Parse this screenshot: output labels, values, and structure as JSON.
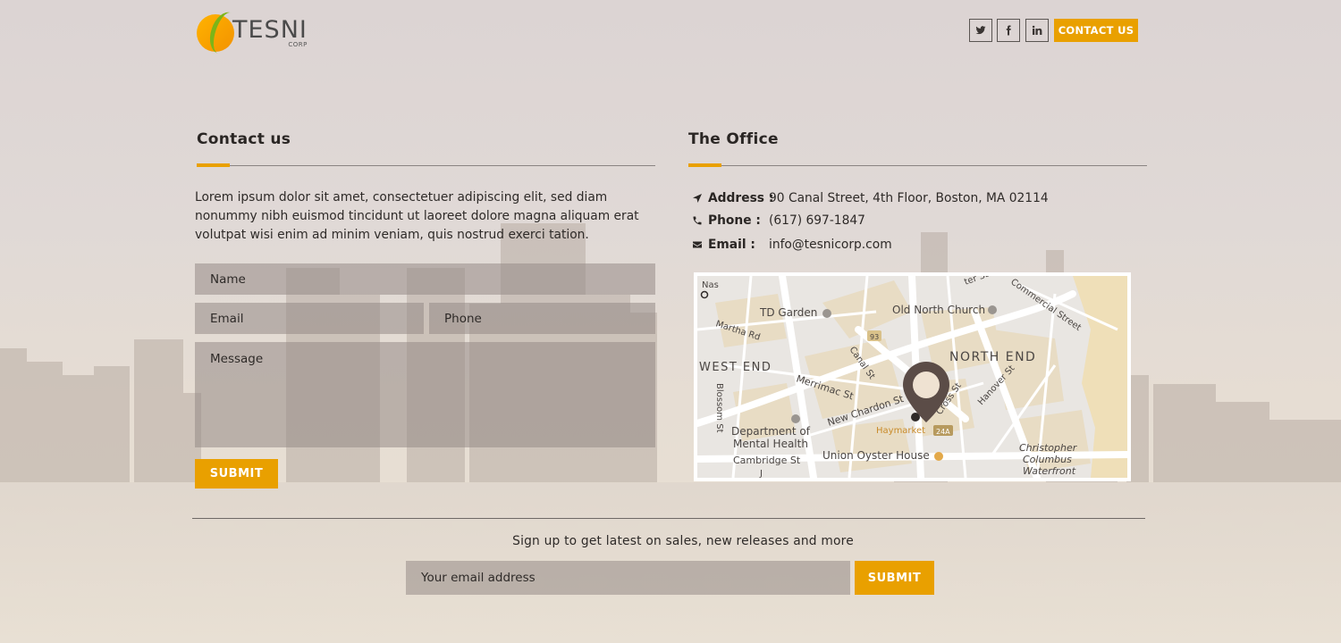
{
  "header": {
    "logo_text": "TESNI",
    "logo_subtext": "CORP",
    "social": [
      {
        "name": "twitter-icon"
      },
      {
        "name": "facebook-icon"
      },
      {
        "name": "linkedin-icon"
      }
    ],
    "contact_button": "CONTACT US"
  },
  "contact": {
    "title": "Contact us",
    "intro": "Lorem ipsum dolor sit amet, consectetuer adipiscing elit, sed diam nonummy nibh euismod tincidunt ut laoreet dolore magna aliquam erat volutpat wisi enim ad minim veniam, quis nostrud exerci tation.",
    "form": {
      "name_placeholder": "Name",
      "email_placeholder": "Email",
      "phone_placeholder": "Phone",
      "message_placeholder": "Message",
      "submit_label": "SUBMIT"
    }
  },
  "office": {
    "title": "The Office",
    "address_label": "Address :",
    "address_value": "90 Canal Street, 4th Floor, Boston, MA 02114",
    "phone_label": "Phone :",
    "phone_value": "(617) 697-1847",
    "email_label": "Email :",
    "email_value": "info@tesnicorp.com",
    "map": {
      "labels": {
        "td_garden": "TD Garden",
        "old_north_church": "Old North Church",
        "martha_rd": "Martha Rd",
        "canal_st": "Canal St",
        "west_end": "WEST END",
        "north_end": "NORTH END",
        "blossom_st": "Blossom St",
        "merrimac_st": "Merrimac St",
        "new_chardon_st": "New Chardon St",
        "cross_st": "Cross St",
        "hanover_st": "Hanover St",
        "dept_line1": "Department of",
        "dept_line2": "Mental Health",
        "haymarket": "Haymarket",
        "route_24a": "24A",
        "route_93": "93",
        "cambridge_st": "Cambridge St",
        "union_oyster": "Union Oyster House",
        "cc_line1": "Christopher",
        "cc_line2": "Columbus",
        "cc_line3": "Waterfront",
        "nashua_st": "Nas",
        "commercial_st": "Commercial Street",
        "ter_st": "ter St",
        "j_st": "J"
      }
    }
  },
  "newsletter": {
    "text": "Sign up to get latest on sales, new releases and more",
    "email_placeholder": "Your email address",
    "submit_label": "SUBMIT"
  },
  "colors": {
    "accent": "#e9a000",
    "map_pin": "#5b4c47"
  }
}
